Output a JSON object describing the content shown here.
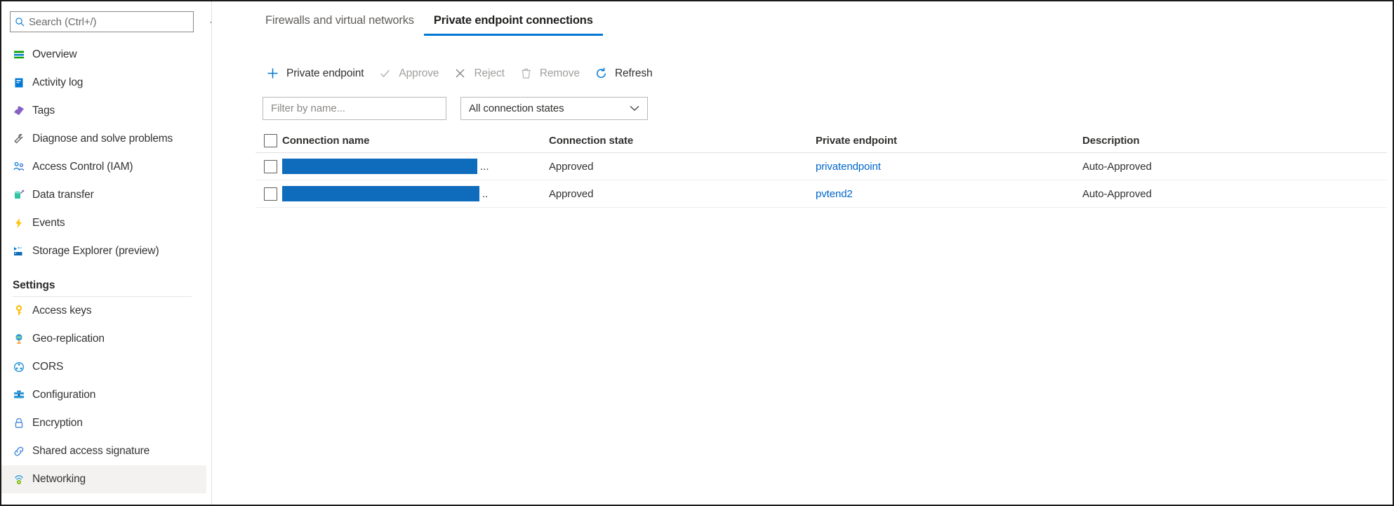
{
  "sidebar": {
    "search": {
      "placeholder": "Search (Ctrl+/)",
      "icon": "search-icon"
    },
    "collapse_glyph": "«",
    "items": [
      {
        "label": "Overview",
        "icon": "overview-icon",
        "selected": false
      },
      {
        "label": "Activity log",
        "icon": "activity-log-icon",
        "selected": false
      },
      {
        "label": "Tags",
        "icon": "tags-icon",
        "selected": false
      },
      {
        "label": "Diagnose and solve problems",
        "icon": "diagnose-icon",
        "selected": false
      },
      {
        "label": "Access Control (IAM)",
        "icon": "access-control-icon",
        "selected": false
      },
      {
        "label": "Data transfer",
        "icon": "data-transfer-icon",
        "selected": false
      },
      {
        "label": "Events",
        "icon": "events-icon",
        "selected": false
      },
      {
        "label": "Storage Explorer (preview)",
        "icon": "storage-explorer-icon",
        "selected": false
      }
    ],
    "settings_section": {
      "title": "Settings",
      "items": [
        {
          "label": "Access keys",
          "icon": "key-icon",
          "selected": false
        },
        {
          "label": "Geo-replication",
          "icon": "globe-icon",
          "selected": false
        },
        {
          "label": "CORS",
          "icon": "cors-icon",
          "selected": false
        },
        {
          "label": "Configuration",
          "icon": "toolbox-icon",
          "selected": false
        },
        {
          "label": "Encryption",
          "icon": "lock-icon",
          "selected": false
        },
        {
          "label": "Shared access signature",
          "icon": "link-icon",
          "selected": false
        },
        {
          "label": "Networking",
          "icon": "networking-icon",
          "selected": true
        }
      ]
    }
  },
  "main": {
    "tabs": [
      {
        "label": "Firewalls and virtual networks",
        "active": false
      },
      {
        "label": "Private endpoint connections",
        "active": true
      }
    ],
    "toolbar": [
      {
        "label": "Private endpoint",
        "icon": "plus-icon",
        "disabled": false
      },
      {
        "label": "Approve",
        "icon": "check-icon",
        "disabled": true
      },
      {
        "label": "Reject",
        "icon": "x-icon",
        "disabled": true
      },
      {
        "label": "Remove",
        "icon": "trash-icon",
        "disabled": true
      },
      {
        "label": "Refresh",
        "icon": "refresh-icon",
        "disabled": false
      }
    ],
    "filters": {
      "name_placeholder": "Filter by name...",
      "state_value": "All connection states",
      "chevron": "chevron-down-icon"
    },
    "table": {
      "columns": [
        "Connection name",
        "Connection state",
        "Private endpoint",
        "Description"
      ],
      "rows": [
        {
          "connection_name": "",
          "connection_name_redacted": true,
          "redaction_width": 278,
          "truncation": "...",
          "connection_state": "Approved",
          "private_endpoint": "privatendpoint",
          "description": "Auto-Approved"
        },
        {
          "connection_name": "",
          "connection_name_redacted": true,
          "redaction_width": 281,
          "truncation": "..",
          "connection_state": "Approved",
          "private_endpoint": "pvtend2",
          "description": "Auto-Approved"
        }
      ]
    }
  },
  "colors": {
    "accent": "#0078d4",
    "link": "#0066cc",
    "redaction": "#0f6cbd",
    "selected_row": "#f3f2f1",
    "disabled_text": "#a19f9d"
  }
}
